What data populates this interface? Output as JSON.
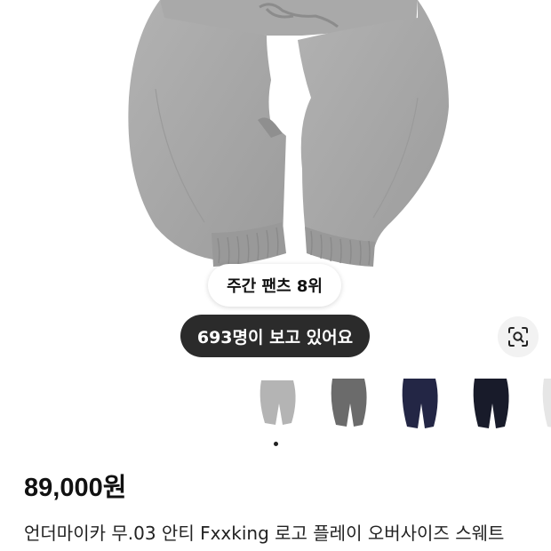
{
  "product": {
    "rank_badge": "주간 팬츠 8위",
    "viewers_badge": "693명이 보고 있어요",
    "price": "89,000원",
    "title": "언더마이카 무.03 안티 Fxxking 로고 플레이 오버사이즈 스웨트"
  },
  "icons": {
    "lens_button": "lens-search-icon"
  },
  "colors": {
    "pants_gray": "#a8a8a8",
    "viewers_bg": "#2b2b2b",
    "thumb_colors": [
      "#b4b4b4",
      "#6b6b6b",
      "#232645",
      "#181b2a",
      "#e6e6e6"
    ]
  },
  "gallery": {
    "thumbnail_count": 5,
    "active_index": 0
  }
}
